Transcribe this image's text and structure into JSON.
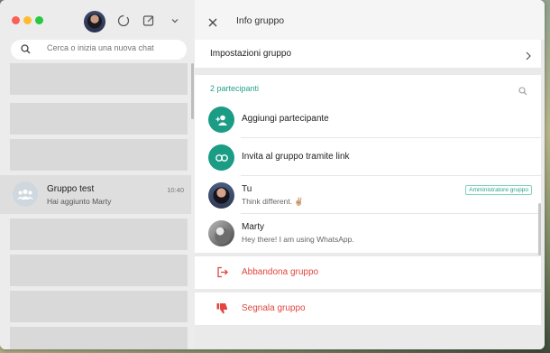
{
  "sidebar": {
    "search_placeholder": "Cerca o inizia una nuova chat",
    "chats": [
      {
        "name": "Gruppo test",
        "last_message": "Hai aggiunto Marty",
        "time": "10:40"
      }
    ]
  },
  "info": {
    "title": "Info gruppo",
    "settings_label": "Impostazioni gruppo",
    "participants_count": "2 partecipanti",
    "add_participant": "Aggiungi partecipante",
    "invite_link": "Invita al gruppo tramite link",
    "participants": [
      {
        "name": "Tu",
        "status": "Think different. ✌🏼",
        "badge": "Amministratore gruppo"
      },
      {
        "name": "Marty",
        "status": "Hey there! I am using WhatsApp."
      }
    ],
    "leave_group": "Abbandona gruppo",
    "report_group": "Segnala gruppo"
  },
  "colors": {
    "accent": "#1b9c85",
    "danger": "#e0463f"
  },
  "icons": [
    "status-icon",
    "new-chat-icon",
    "chevron-down-icon",
    "search-icon",
    "close-icon",
    "chevron-right-icon",
    "add-person-icon",
    "link-icon",
    "exit-icon",
    "thumbs-down-icon"
  ]
}
